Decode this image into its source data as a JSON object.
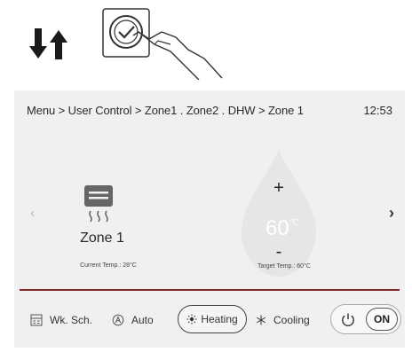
{
  "breadcrumb": "Menu > User Control > Zone1 . Zone2 . DHW  > Zone 1",
  "clock": "12:53",
  "nav": {
    "prev": "‹",
    "next": "›"
  },
  "zone": {
    "name": "Zone 1",
    "current_temp": "Current Temp.: 28°C"
  },
  "target": {
    "plus": "+",
    "value": "60",
    "unit": "°C",
    "minus": "-",
    "label": "Target Temp.: 60°C"
  },
  "toolbar": {
    "wk_sch": "Wk. Sch.",
    "auto": "Auto",
    "heating": "Heating",
    "cooling": "Cooling",
    "on": "ON"
  },
  "colors": {
    "divider": "#7a2a2a",
    "drop": "#e6e6e6",
    "panel": "#f0f0f0"
  },
  "icons": {
    "arrows": "down-up-arrows-icon",
    "hand": "hand-pressing-check-button-icon",
    "zone": "radiator-heating-icon",
    "wk_sch": "calendar-icon",
    "auto": "auto-mode-icon",
    "heating": "sun-icon",
    "cooling": "snowflake-icon",
    "power": "power-icon"
  }
}
